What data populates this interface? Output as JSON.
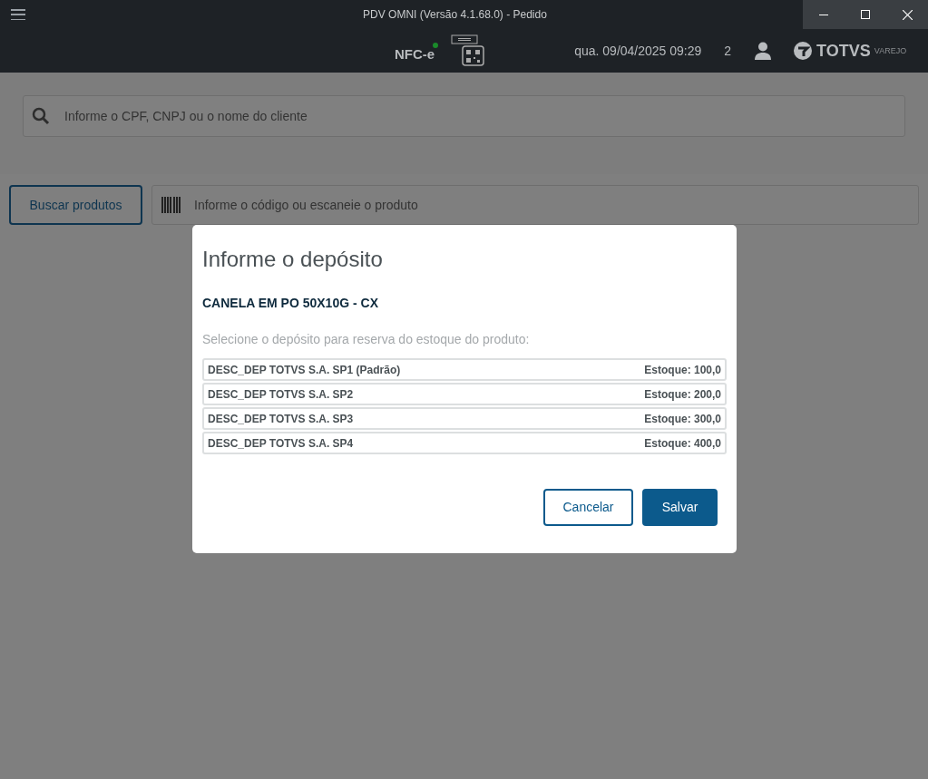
{
  "window": {
    "title": "PDV OMNI (Versão 4.1.68.0) - Pedido"
  },
  "header": {
    "fiscal_mode": "NFC-e",
    "datetime": "qua. 09/04/2025 09:29",
    "count": "2",
    "logo": {
      "name": "TOTVS",
      "tagline": "VAREJO"
    }
  },
  "client_search": {
    "placeholder": "Informe o CPF, CNPJ ou o nome do cliente"
  },
  "product_bar": {
    "button": "Buscar produtos",
    "placeholder": "Informe o código ou escaneie o produto"
  },
  "dialog": {
    "title": "Informe o depósito",
    "product": "CANELA EM PO 50X10G - CX",
    "instruction": "Selecione o depósito para reserva do estoque do produto:",
    "deposits": [
      {
        "name": "DESC_DEP TOTVS S.A. SP1 (Padrão)",
        "stock": "Estoque: 100,0"
      },
      {
        "name": "DESC_DEP TOTVS S.A. SP2",
        "stock": "Estoque: 200,0"
      },
      {
        "name": "DESC_DEP TOTVS S.A. SP3",
        "stock": "Estoque: 300,0"
      },
      {
        "name": "DESC_DEP TOTVS S.A. SP4",
        "stock": "Estoque: 400,0"
      }
    ],
    "buttons": [
      {
        "label": "Cancelar",
        "kind": "secondary"
      },
      {
        "label": "Salvar",
        "kind": "primary"
      }
    ]
  }
}
